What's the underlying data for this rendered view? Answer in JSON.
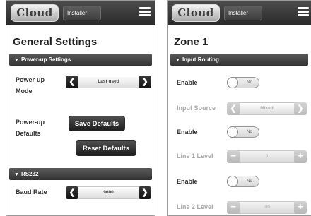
{
  "left_screen": {
    "logo": "Cloud",
    "role": "Installer",
    "title": "General Settings",
    "power_up_section": "Power-up Settings",
    "power_up_mode_label": "Power-up Mode",
    "power_up_mode_value": "Last used",
    "power_up_defaults_label": "Power-up Defaults",
    "save_defaults": "Save Defaults",
    "reset_defaults": "Reset Defaults",
    "rs232_section": "RS232",
    "baud_rate_label": "Baud Rate",
    "baud_rate_value": "9600"
  },
  "right_screen": {
    "logo": "Cloud",
    "role": "Installer",
    "title": "Zone 1",
    "input_routing_section": "Input Routing",
    "enable_label": "Enable",
    "toggle_off": "No",
    "input_source_label": "Input Source",
    "input_source_value": "Mixed",
    "line1_label": "Line 1 Level",
    "line1_value": "0",
    "line2_label": "Line 2 Level",
    "line2_value": "-90"
  },
  "icons": {
    "menu": "hamburger-menu-icon",
    "left_arrow": "left-arrow-icon",
    "right_arrow": "right-arrow-icon",
    "chevron": "chevron-down-icon"
  }
}
